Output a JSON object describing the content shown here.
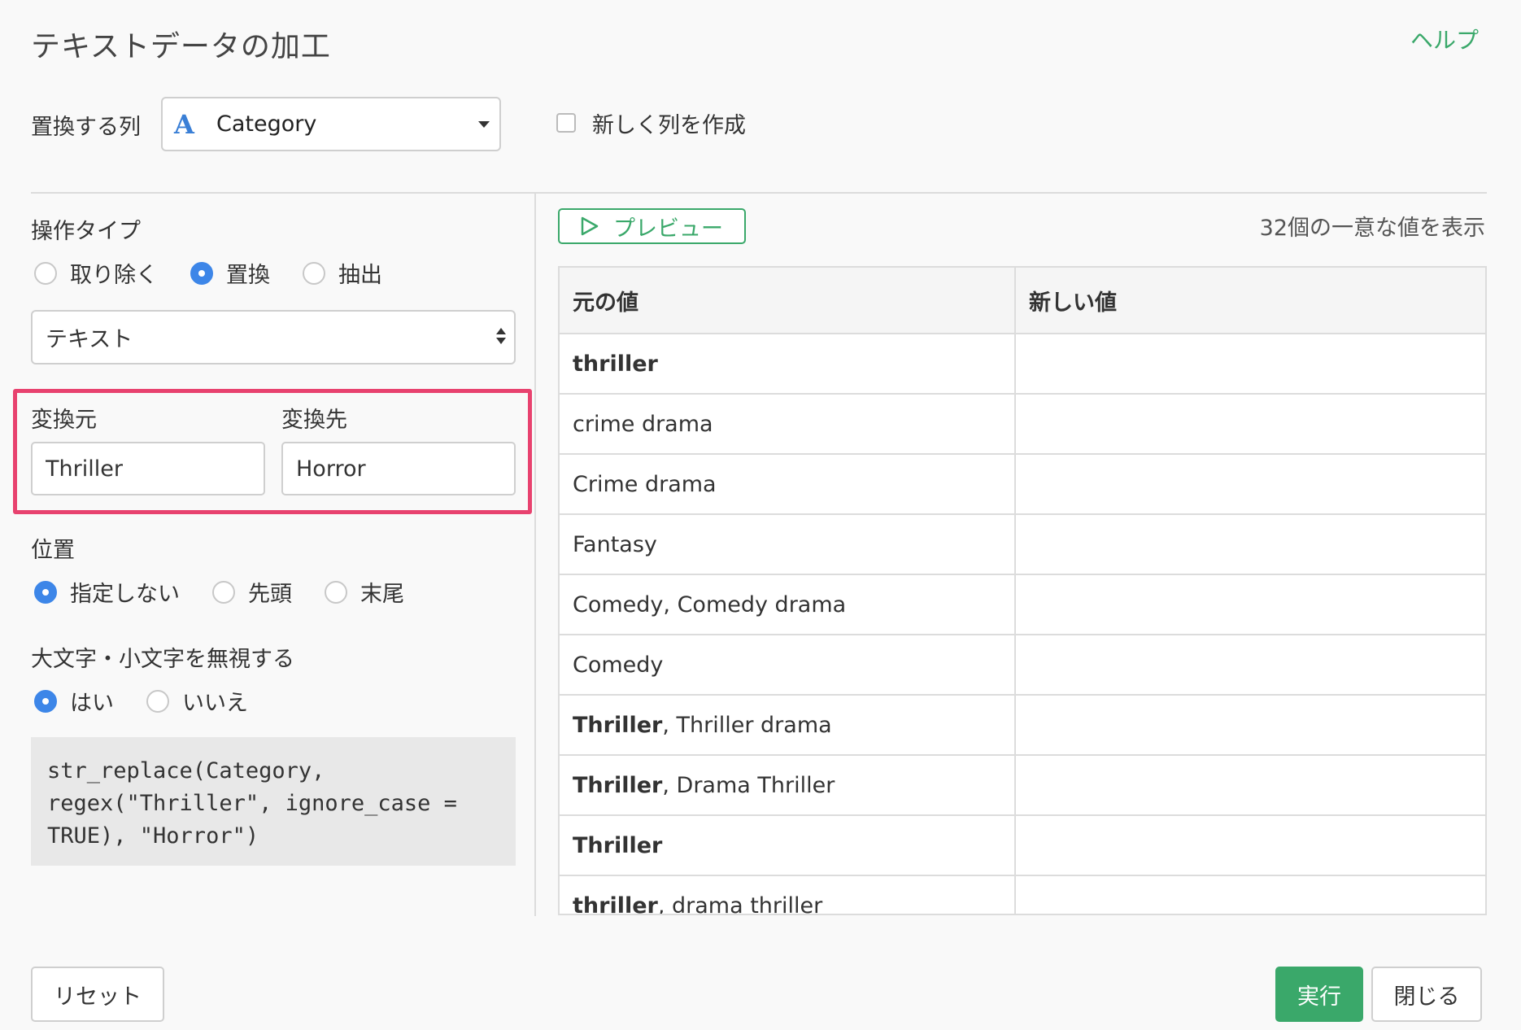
{
  "header": {
    "title": "テキストデータの加工",
    "help_label": "ヘルプ"
  },
  "target_column": {
    "label": "置換する列",
    "type_icon": "A",
    "selected": "Category",
    "new_column_label": "新しく列を作成",
    "new_column_checked": false
  },
  "operation": {
    "label": "操作タイプ",
    "options": [
      "取り除く",
      "置換",
      "抽出"
    ],
    "selected": "置換",
    "match_type": "テキスト"
  },
  "replace": {
    "from_label": "変換元",
    "to_label": "変換先",
    "from_value": "Thriller",
    "to_value": "Horror"
  },
  "position": {
    "label": "位置",
    "options": [
      "指定しない",
      "先頭",
      "末尾"
    ],
    "selected": "指定しない"
  },
  "ignore_case": {
    "label": "大文字・小文字を無視する",
    "options": [
      "はい",
      "いいえ"
    ],
    "selected": "はい"
  },
  "code": "str_replace(Category,\nregex(\"Thriller\", ignore_case =\nTRUE), \"Horror\")",
  "preview": {
    "button_label": "プレビュー",
    "unique_info": "32個の一意な値を表示",
    "columns": [
      "元の値",
      "新しい値"
    ],
    "rows": [
      {
        "match": "thriller",
        "rest": "",
        "new": ""
      },
      {
        "match": "",
        "rest": "crime drama",
        "new": ""
      },
      {
        "match": "",
        "rest": "Crime drama",
        "new": ""
      },
      {
        "match": "",
        "rest": "Fantasy",
        "new": ""
      },
      {
        "match": "",
        "rest": "Comedy, Comedy drama",
        "new": ""
      },
      {
        "match": "",
        "rest": "Comedy",
        "new": ""
      },
      {
        "match": "Thriller",
        "rest": ", Thriller drama",
        "new": ""
      },
      {
        "match": "Thriller",
        "rest": ", Drama Thriller",
        "new": ""
      },
      {
        "match": "Thriller",
        "rest": "",
        "new": ""
      },
      {
        "match": "thriller",
        "rest": ", drama thriller",
        "new": ""
      }
    ]
  },
  "footer": {
    "reset_label": "リセット",
    "run_label": "実行",
    "close_label": "閉じる"
  },
  "colors": {
    "accent": "#3aa86a",
    "radio": "#3d86e8",
    "highlight": "#e8426f"
  }
}
